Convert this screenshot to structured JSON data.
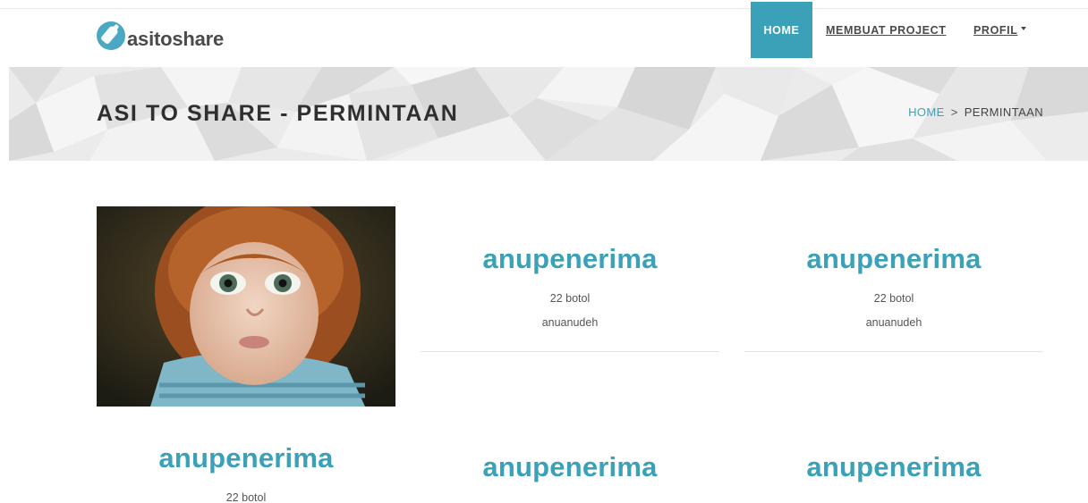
{
  "header": {
    "logo_text": "asitoshare",
    "logo_icon": "bottle-icon",
    "nav": {
      "home": "HOME",
      "project": "MEMBUAT PROJECT",
      "profil": "PROFIL"
    }
  },
  "banner": {
    "title": "ASI TO SHARE - PERMINTAAN",
    "breadcrumb": {
      "home": "HOME",
      "separator": ">",
      "current": "PERMINTAAN"
    }
  },
  "cards": [
    {
      "title": "anupenerima",
      "qty": "22 botol",
      "desc": "anuanudeh"
    },
    {
      "title": "anupenerima",
      "qty": "22 botol",
      "desc": "anuanudeh"
    },
    {
      "title": "anupenerima",
      "qty": "22 botol"
    },
    {
      "title": "anupenerima"
    },
    {
      "title": "anupenerima"
    }
  ],
  "colors": {
    "accent": "#3ba1b8",
    "text_dark": "#2f2f2f"
  }
}
